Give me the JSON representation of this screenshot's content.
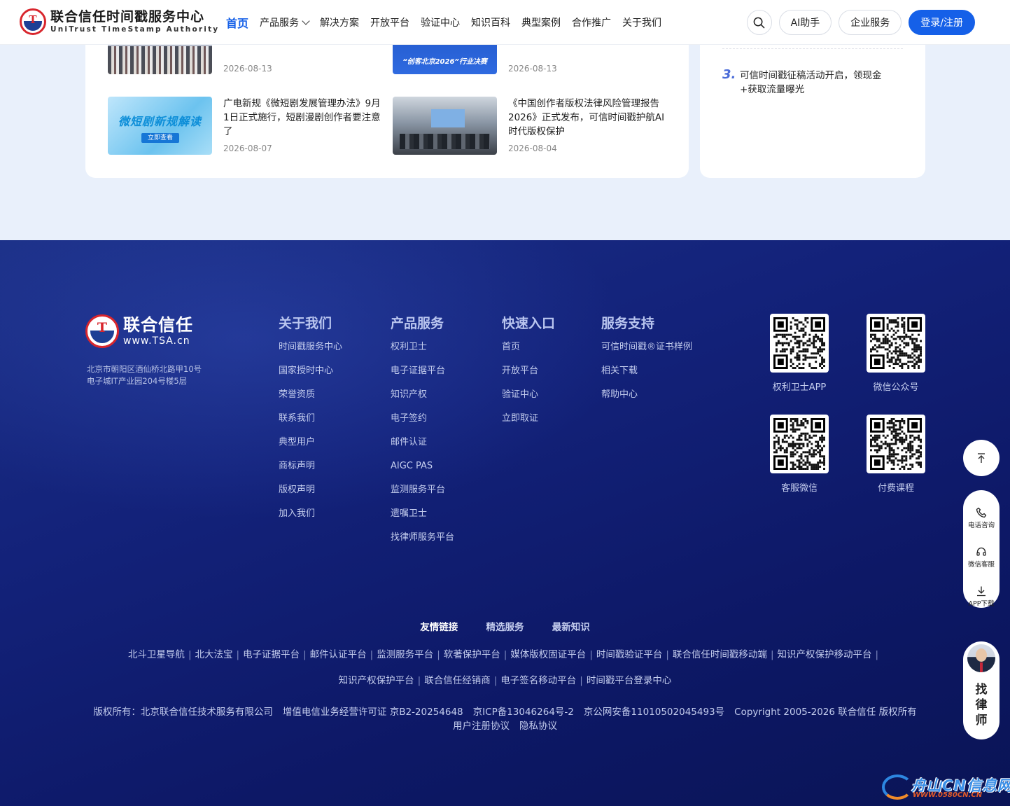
{
  "header": {
    "logo_cn": "联合信任时间戳服务中心",
    "logo_en": "UniTrust TimeStamp Authority",
    "logo_mark": "T",
    "nav": [
      {
        "label": "首页",
        "active": true
      },
      {
        "label": "产品服务",
        "dropdown": true
      },
      {
        "label": "解决方案"
      },
      {
        "label": "开放平台"
      },
      {
        "label": "验证中心"
      },
      {
        "label": "知识百科"
      },
      {
        "label": "典型案例"
      },
      {
        "label": "合作推广"
      },
      {
        "label": "关于我们"
      }
    ],
    "ai_label": "AI助手",
    "enterprise_label": "企业服务",
    "login_label": "登录/注册"
  },
  "news": {
    "items": [
      {
        "title": "",
        "date": "2026-08-13"
      },
      {
        "title": "",
        "date": "2026-08-13",
        "thumb_caption": "“创客北京2026”行业决赛"
      },
      {
        "title": "广电新规《微短剧发展管理办法》9月1日正式施行，短剧漫剧创作者要注意了",
        "date": "2026-08-07",
        "thumb_title": "微短剧新规解读",
        "thumb_button": "立即查看"
      },
      {
        "title": "《中国创作者版权法律风险管理报告2026》正式发布，可信时间戳护航AI时代版权保护",
        "date": "2026-08-04"
      }
    ]
  },
  "ranking": {
    "num": "3.",
    "title": "可信时间戳征稿活动开启，领现金+获取流量曝光"
  },
  "footer": {
    "logo_cn": "联合信任",
    "logo_en": "www.TSA.cn",
    "logo_mark": "T",
    "address": "北京市朝阳区酒仙桥北路甲10号电子城IT产业园204号楼5层",
    "columns": [
      {
        "title": "关于我们",
        "items": [
          "时间戳服务中心",
          "国家授时中心",
          "荣誉资质",
          "联系我们",
          "典型用户",
          "商标声明",
          "版权声明",
          "加入我们"
        ]
      },
      {
        "title": "产品服务",
        "items": [
          "权利卫士",
          "电子证据平台",
          "知识产权",
          "电子签约",
          "邮件认证",
          "AIGC PAS",
          "监测服务平台",
          "遗嘱卫士",
          "找律师服务平台"
        ]
      },
      {
        "title": "快速入口",
        "items": [
          "首页",
          "开放平台",
          "验证中心",
          "立即取证"
        ]
      },
      {
        "title": "服务支持",
        "items": [
          "可信时间戳®证书样例",
          "相关下载",
          "帮助中心"
        ]
      }
    ],
    "qrcodes": [
      {
        "label": "权利卫士APP"
      },
      {
        "label": "微信公众号"
      },
      {
        "label": "客服微信"
      },
      {
        "label": "付费课程"
      }
    ],
    "link_tabs": [
      "友情链接",
      "精选服务",
      "最新知识"
    ],
    "links_row1": [
      "北斗卫星导航",
      "北大法宝",
      "电子证据平台",
      "邮件认证平台",
      "监测服务平台",
      "软著保护平台",
      "媒体版权固证平台",
      "时间戳验证平台",
      "联合信任时间戳移动端",
      "知识产权保护移动平台"
    ],
    "links_row2": [
      "知识产权保护平台",
      "联合信任经销商",
      "电子签名移动平台",
      "时间戳平台登录中心"
    ],
    "copyright_row1": [
      "版权所有：北京联合信任技术服务有限公司",
      "增值电信业务经营许可证 京B2-20254648",
      "京ICP备13046264号-2",
      "京公网安备11010502045493号",
      "Copyright 2005-2026 联合信任 版权所有"
    ],
    "copyright_row2": [
      "用户注册协议",
      "隐私协议"
    ]
  },
  "side_tools": {
    "phone_label": "电话咨询",
    "wechat_label": "微信客服",
    "app_label": "APP下载",
    "lawyer_label": "找律师"
  },
  "watermark": {
    "text": "舟山CN信息网",
    "url": "WWW.0580CN.CN"
  },
  "colors": {
    "primary": "#1560e8",
    "footer_bg": "#13227a",
    "logo_red": "#d8262d"
  }
}
